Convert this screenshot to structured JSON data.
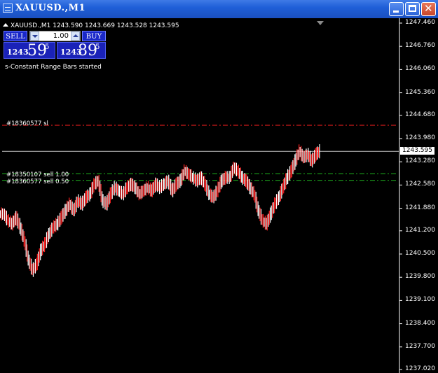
{
  "window": {
    "title": "XAUUSD.,M1",
    "min_icon": "minimize-icon",
    "max_icon": "maximize-icon",
    "close_icon": "close-icon"
  },
  "chart_header": {
    "symbol_line": "XAUUSD.,M1  1243.590 1243.669 1243.528 1243.595"
  },
  "trade_panel": {
    "sell_label": "SELL",
    "buy_label": "BUY",
    "lot_value": "1.00",
    "sell_big": "1243",
    "sell_pips": "59",
    "sell_point": "5",
    "buy_big": "1243",
    "buy_pips": "89",
    "buy_point": "5"
  },
  "status_message": "s-Constant Range Bars started",
  "order_lines": [
    {
      "label": "#18360577 sl",
      "price": 1244.38,
      "color": "#ff2020",
      "style": "dashdot"
    },
    {
      "label": "#18350107 sell 1.00",
      "price": 1242.92,
      "color": "#1fb51f",
      "style": "dashdot"
    },
    {
      "label": "#18360577 sell 0.50",
      "price": 1242.72,
      "color": "#1fb51f",
      "style": "dashdot"
    }
  ],
  "current_price": "1243.595",
  "price_axis": [
    "1247.460",
    "1246.760",
    "1246.060",
    "1245.360",
    "1244.680",
    "1243.980",
    "1243.280",
    "1242.580",
    "1241.880",
    "1241.200",
    "1240.500",
    "1239.800",
    "1239.100",
    "1238.400",
    "1237.700",
    "1237.020"
  ],
  "colors": {
    "background": "#000000",
    "bar_up": "#ffffff",
    "bar_down": "#ff2020",
    "bid_line": "#c0c0c0",
    "title_bar": "#1f5fd8"
  },
  "chart_data": {
    "type": "line",
    "title": "XAUUSD.,M1",
    "ylim": [
      1237.02,
      1247.46
    ],
    "y_ticks": [
      1247.46,
      1246.76,
      1246.06,
      1245.36,
      1244.68,
      1243.98,
      1243.28,
      1242.58,
      1241.88,
      1241.2,
      1240.5,
      1239.8,
      1239.1,
      1238.4,
      1237.7,
      1237.02
    ],
    "series": [
      {
        "values": [
          1241.7,
          1241.5,
          1241.4,
          1241.6,
          1241.3,
          1240.9,
          1240.3,
          1240.0,
          1240.2,
          1240.6,
          1240.8,
          1241.1,
          1241.3,
          1241.4,
          1241.6,
          1241.8,
          1242.0,
          1241.8,
          1242.1,
          1242.0,
          1242.2,
          1242.3,
          1242.6,
          1242.7,
          1242.1,
          1242.0,
          1242.3,
          1242.5,
          1242.4,
          1242.3,
          1242.5,
          1242.6,
          1242.5,
          1242.3,
          1242.4,
          1242.5,
          1242.4,
          1242.6,
          1242.5,
          1242.6,
          1242.7,
          1242.4,
          1242.6,
          1242.7,
          1243.0,
          1242.9,
          1242.8,
          1242.7,
          1242.8,
          1242.6,
          1242.3,
          1242.2,
          1242.4,
          1242.7,
          1242.8,
          1242.8,
          1243.1,
          1243.0,
          1242.8,
          1242.7,
          1242.5,
          1242.3,
          1241.8,
          1241.5,
          1241.4,
          1241.7,
          1242.0,
          1242.2,
          1242.5,
          1242.8,
          1243.0,
          1243.3,
          1243.6,
          1243.4,
          1243.5,
          1243.3,
          1243.5,
          1243.6
        ]
      }
    ]
  }
}
